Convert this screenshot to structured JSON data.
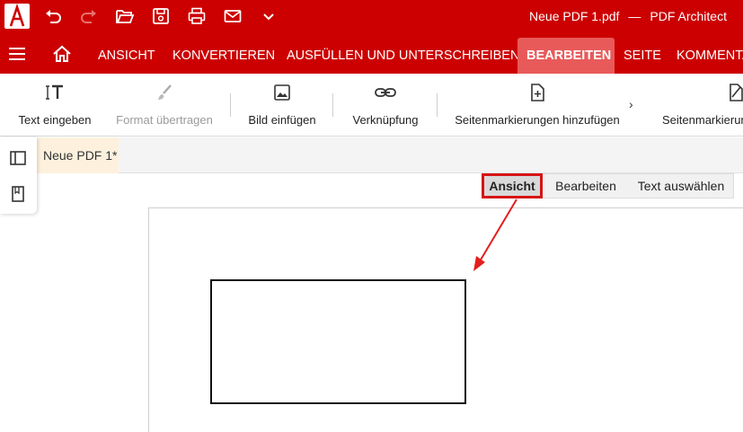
{
  "titlebar": {
    "document": "Neue PDF 1.pdf",
    "separator": "—",
    "app": "PDF Architect",
    "quick_access": [
      "undo-icon",
      "redo-icon",
      "folder-open-icon",
      "save-icon",
      "print-icon",
      "mail-icon",
      "chevron-down-icon"
    ]
  },
  "menu": {
    "items": [
      "ANSICHT",
      "KONVERTIEREN",
      "AUSFÜLLEN UND UNTERSCHREIBEN",
      "BEARBEITEN",
      "SEITE",
      "KOMMENTAR"
    ],
    "active": "BEARBEITEN"
  },
  "ribbon": {
    "text_input": "Text eingeben",
    "format_transfer": "Format übertragen",
    "insert_image": "Bild einfügen",
    "link": "Verknüpfung",
    "add_bookmarks": "Seitenmarkierungen hinzufügen",
    "bookmarks_more": "Seitenmarkierun",
    "more_arrow": "›"
  },
  "doc_tab": {
    "label": "Neue PDF 1*"
  },
  "modes": {
    "view": "Ansicht",
    "edit": "Bearbeiten",
    "select_text": "Text auswählen",
    "selected": "Ansicht"
  },
  "colors": {
    "brand": "#cc0000",
    "active_tab": "#e85a5a",
    "highlight": "#d71414",
    "doc_tab": "#fdf1dd"
  }
}
